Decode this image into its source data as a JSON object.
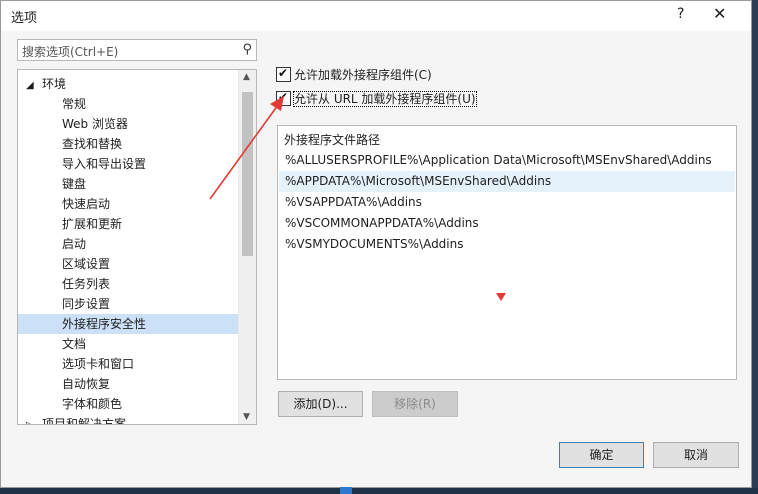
{
  "window": {
    "title": "选项",
    "help_glyph": "?",
    "close_glyph": "✕"
  },
  "search": {
    "placeholder": "搜索选项(Ctrl+E)"
  },
  "tree": {
    "items": [
      {
        "label": "环境",
        "level": 0,
        "expanded": true
      },
      {
        "label": "常规",
        "level": 1
      },
      {
        "label": "Web 浏览器",
        "level": 1
      },
      {
        "label": "查找和替换",
        "level": 1
      },
      {
        "label": "导入和导出设置",
        "level": 1
      },
      {
        "label": "键盘",
        "level": 1
      },
      {
        "label": "快速启动",
        "level": 1
      },
      {
        "label": "扩展和更新",
        "level": 1
      },
      {
        "label": "启动",
        "level": 1
      },
      {
        "label": "区域设置",
        "level": 1
      },
      {
        "label": "任务列表",
        "level": 1
      },
      {
        "label": "同步设置",
        "level": 1
      },
      {
        "label": "外接程序安全性",
        "level": 1,
        "selected": true
      },
      {
        "label": "文档",
        "level": 1
      },
      {
        "label": "选项卡和窗口",
        "level": 1
      },
      {
        "label": "自动恢复",
        "level": 1
      },
      {
        "label": "字体和颜色",
        "level": 1
      },
      {
        "label": "项目和解决方案",
        "level": 0,
        "expanded": false
      }
    ]
  },
  "options": {
    "allow_components": {
      "label": "允许加载外接程序组件(C)",
      "checked": true
    },
    "allow_url_components": {
      "label": "允许从 URL 加载外接程序组件(U)",
      "checked": true
    }
  },
  "paths": {
    "header": "外接程序文件路径",
    "rows": [
      "%ALLUSERSPROFILE%\\Application Data\\Microsoft\\MSEnvShared\\Addins",
      "%APPDATA%\\Microsoft\\MSEnvShared\\Addins",
      "%VSAPPDATA%\\Addins",
      "%VSCOMMONAPPDATA%\\Addins",
      "%VSMYDOCUMENTS%\\Addins"
    ],
    "selected_index": 1
  },
  "buttons": {
    "add": "添加(D)...",
    "remove": "移除(R)",
    "ok": "确定",
    "cancel": "取消"
  },
  "colors": {
    "selection": "#cce0f7",
    "annotation": "#e53935",
    "accent": "#3c7fb1"
  }
}
